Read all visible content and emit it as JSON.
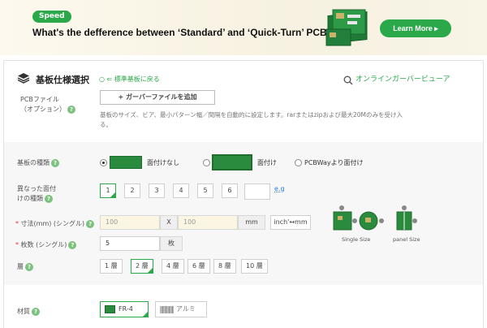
{
  "banner": {
    "badge": "Speed",
    "title": "What's the defference between ‘Standard’ and ‘Quick-Turn’ PCB",
    "cta": "Learn More ▸"
  },
  "section": {
    "title": "基板仕様選択",
    "standard_link": "○ ⇐ 標準基板に戻る",
    "viewer": "オンラインガーバービューア"
  },
  "gerber": {
    "label_line1": "PCBファイル",
    "label_line2": "（オプション）",
    "button": "+ ガーバーファイルを追加",
    "note_line1": "基板のサイズ、ビア、最小パターン幅／間隔を自動的に設定します。rarまたはzipおよび最大20Mのみを受け入",
    "note_line2": "る。"
  },
  "board_type": {
    "label": "基板の種類",
    "options": [
      "面付けなし",
      "面付け",
      "PCBWayより面付け"
    ],
    "selected": 0
  },
  "design_count": {
    "label_line1": "異なった面付",
    "label_line2": "けの種類",
    "values": [
      "1",
      "2",
      "3",
      "4",
      "5",
      "6"
    ],
    "selected": 0,
    "eg": "e.g"
  },
  "size": {
    "label": "寸法(mm) (シングル)",
    "width_placeholder": "100",
    "x": "X",
    "height_placeholder": "100",
    "unit": "mm",
    "convert": "inch'↔mm",
    "single_caption": "Single Size",
    "panel_caption": "panel Size"
  },
  "quantity": {
    "label": "枚数 (シングル)",
    "value": "5",
    "unit": "枚"
  },
  "layers": {
    "label": "層",
    "values": [
      "1 層",
      "2 層",
      "4 層",
      "6 層",
      "8 層",
      "10 層"
    ],
    "selected": 1
  },
  "material": {
    "label": "材質",
    "options": [
      "FR-4",
      "アルミ"
    ],
    "selected": 0
  },
  "colors": {
    "accent": "#2aa84a",
    "pcb": "#2a8a3e",
    "link_blue": "#2a7ad5"
  }
}
